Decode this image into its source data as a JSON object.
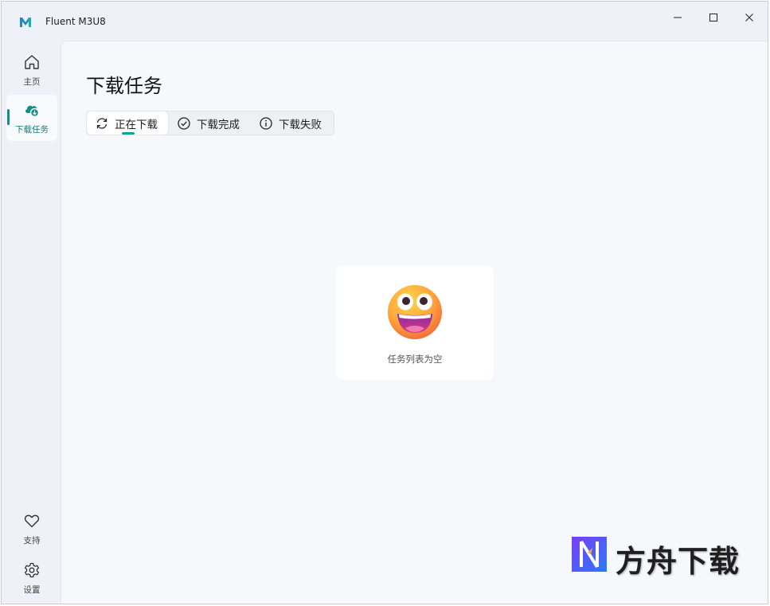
{
  "app": {
    "title": "Fluent M3U8",
    "logo_icon": "m3u8-logo-icon"
  },
  "window_controls": {
    "minimize": "minimize-icon",
    "maximize": "maximize-icon",
    "close": "close-icon"
  },
  "nav": {
    "items": [
      {
        "label": "主页",
        "icon": "home-icon"
      },
      {
        "label": "下载任务",
        "icon": "cloud-download-icon"
      }
    ],
    "bottom_items": [
      {
        "label": "支持",
        "icon": "heart-icon"
      },
      {
        "label": "设置",
        "icon": "gear-icon"
      }
    ]
  },
  "page": {
    "title": "下载任务",
    "tabs": [
      {
        "label": "正在下载",
        "icon": "refresh-icon"
      },
      {
        "label": "下载完成",
        "icon": "check-circle-icon"
      },
      {
        "label": "下载失败",
        "icon": "info-circle-icon"
      }
    ],
    "empty_state": {
      "text": "任务列表为空",
      "icon": "grinning-face-icon"
    }
  },
  "watermark": {
    "text": "方舟下载",
    "icon": "fangzhou-logo-icon"
  },
  "colors": {
    "accent": "#0f8f8a",
    "content_bg": "#f7f8fb",
    "window_bg": "#eef1f8"
  }
}
